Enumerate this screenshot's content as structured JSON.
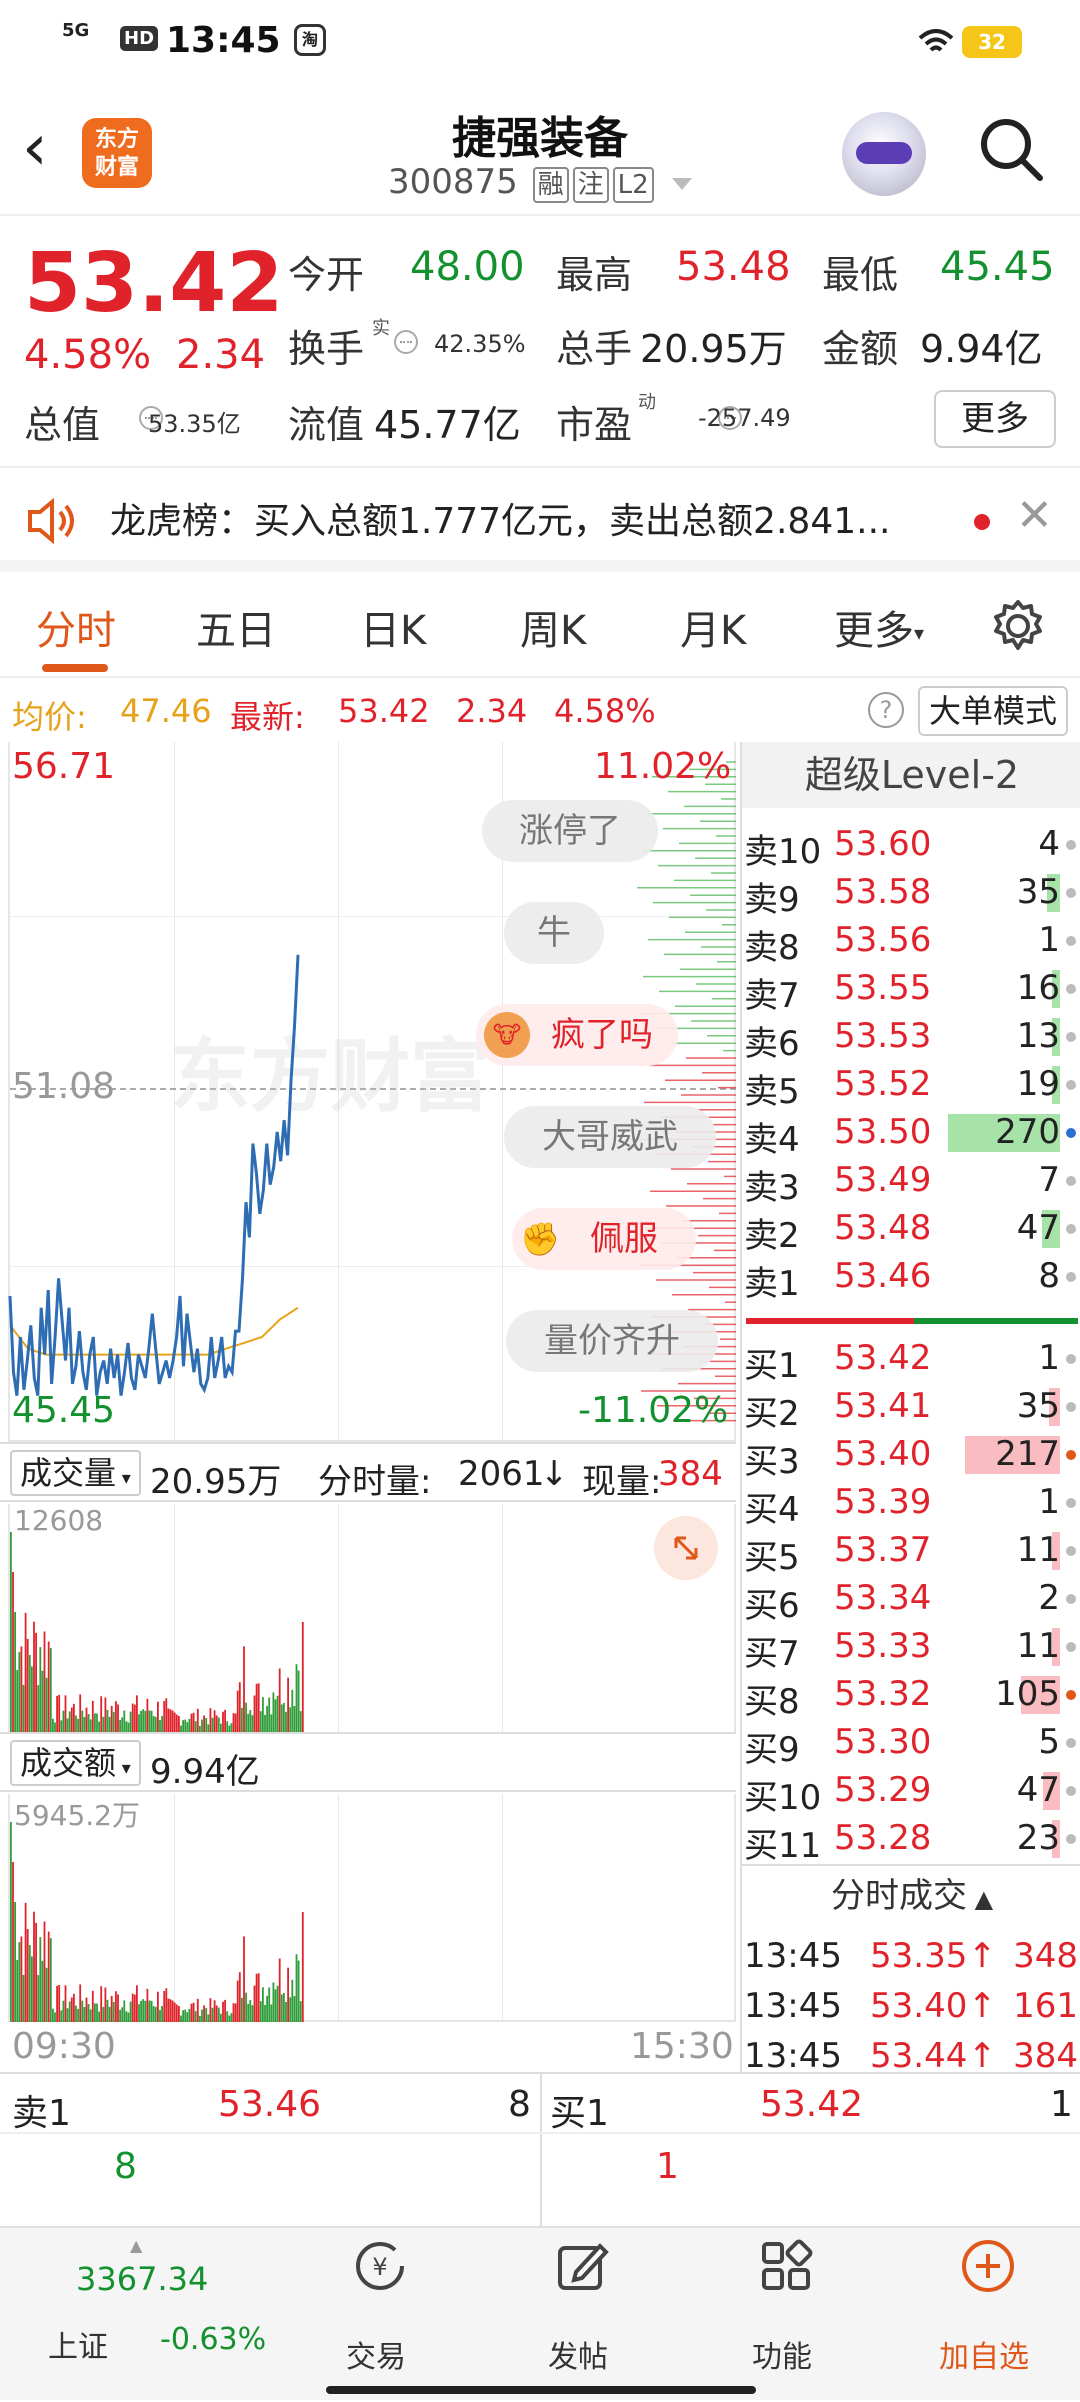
{
  "status": {
    "network": "5G",
    "hd": "HD",
    "time": "13:45",
    "taobao": "淘",
    "battery": "32"
  },
  "header": {
    "back": "‹",
    "logo_line1": "东方",
    "logo_line2": "财富",
    "title": "捷强装备",
    "code": "300875",
    "tags": [
      "融",
      "注",
      "L2"
    ]
  },
  "quote": {
    "price": "53.42",
    "pct": "4.58%",
    "change": "2.34",
    "open_label": "今开",
    "open": "48.00",
    "high_label": "最高",
    "high": "53.48",
    "low_label": "最低",
    "low": "45.45",
    "turnover_label": "换手",
    "turnover_sup": "实",
    "turnover": "42.35%",
    "volume_label": "总手",
    "volume": "20.95万",
    "amount_label": "金额",
    "amount": "9.94亿",
    "mktcap_label": "总值",
    "mktcap": "53.35亿",
    "float_label": "流值",
    "float": "45.77亿",
    "pe_label": "市盈",
    "pe_sup": "动",
    "pe": "-257.49",
    "more": "更多"
  },
  "ticker": {
    "text": "龙虎榜：买入总额1.777亿元，卖出总额2.841..."
  },
  "tabs": [
    "分时",
    "五日",
    "日K",
    "周K",
    "月K",
    "更多"
  ],
  "avg_row": {
    "avg_label": "均价:",
    "avg": "47.46",
    "latest_label": "最新:",
    "latest": "53.42",
    "change": "2.34",
    "pct": "4.58%",
    "mode_btn": "大单模式"
  },
  "chart": {
    "y_high": "56.71",
    "y_mid": "51.08",
    "y_low": "45.45",
    "pct_high": "11.02%",
    "pct_low": "-11.02%",
    "watermark": "东方财富",
    "bubbles": [
      "涨停了",
      "牛",
      "疯了吗",
      "大哥威武",
      "佩服",
      "量价齐升"
    ],
    "vol_select": "成交量",
    "vol_total": "20.95万",
    "vol_tick_label": "分时量:",
    "vol_tick": "2061",
    "vol_tick_arrow": "↓",
    "vol_now_label": "现量:",
    "vol_now": "384",
    "vol_max": "12608",
    "amt_select": "成交额",
    "amt_total": "9.94亿",
    "amt_max": "5945.2万",
    "time_start": "09:30",
    "time_end": "15:30"
  },
  "chart_data": {
    "type": "line",
    "x": [
      "09:30",
      "13:45"
    ],
    "y_range": [
      45.45,
      56.71
    ],
    "reference": 51.08,
    "price": [
      47.6,
      46.3,
      45.9,
      46.9,
      46.0,
      46.5,
      47.1,
      46.2,
      45.9,
      47.4,
      46.6,
      47.7,
      46.1,
      46.9,
      47.9,
      47.2,
      46.5,
      47.4,
      46.1,
      46.4,
      47.0,
      46.3,
      46.0,
      46.6,
      46.9,
      45.9,
      46.3,
      46.5,
      46.1,
      46.7,
      46.2,
      46.6,
      45.9,
      46.3,
      46.8,
      46.2,
      46.0,
      46.6,
      46.4,
      46.2,
      46.7,
      47.3,
      46.7,
      46.1,
      46.3,
      46.5,
      46.2,
      46.5,
      46.9,
      47.6,
      46.4,
      47.3,
      46.8,
      46.3,
      46.7,
      46.1,
      46.0,
      46.2,
      46.9,
      46.2,
      46.5,
      46.9,
      46.2,
      46.4,
      46.3,
      47.0,
      47.0,
      47.9,
      49.2,
      48.6,
      50.2,
      49.7,
      49.0,
      49.4,
      50.2,
      49.5,
      49.8,
      50.4,
      49.9,
      50.6,
      50.0,
      51.3,
      52.2,
      53.42
    ],
    "avg": [
      47.1,
      46.7,
      46.6,
      46.6,
      46.6,
      46.6,
      46.6,
      46.6,
      46.6,
      46.6,
      46.6,
      46.6,
      46.7,
      46.8,
      46.9,
      47.2,
      47.4
    ],
    "volume_bars_note": "intraday volume bars, red up / green down",
    "title": "",
    "xlabel": "",
    "ylabel": ""
  },
  "book": {
    "title": "超级Level-2",
    "asks": [
      {
        "label": "卖10",
        "price": "53.60",
        "vol": "4",
        "bar": 0
      },
      {
        "label": "卖9",
        "price": "53.58",
        "vol": "35",
        "bar": 0.12
      },
      {
        "label": "卖8",
        "price": "53.56",
        "vol": "1",
        "bar": 0
      },
      {
        "label": "卖7",
        "price": "53.55",
        "vol": "16",
        "bar": 0.05
      },
      {
        "label": "卖6",
        "price": "53.53",
        "vol": "13",
        "bar": 0.04
      },
      {
        "label": "卖5",
        "price": "53.52",
        "vol": "19",
        "bar": 0.06
      },
      {
        "label": "卖4",
        "price": "53.50",
        "vol": "270",
        "bar": 1.0
      },
      {
        "label": "卖3",
        "price": "53.49",
        "vol": "7",
        "bar": 0
      },
      {
        "label": "卖2",
        "price": "53.48",
        "vol": "47",
        "bar": 0.16
      },
      {
        "label": "卖1",
        "price": "53.46",
        "vol": "8",
        "bar": 0
      }
    ],
    "bids": [
      {
        "label": "买1",
        "price": "53.42",
        "vol": "1",
        "bar": 0
      },
      {
        "label": "买2",
        "price": "53.41",
        "vol": "35",
        "bar": 0.1
      },
      {
        "label": "买3",
        "price": "53.40",
        "vol": "217",
        "bar": 0.85
      },
      {
        "label": "买4",
        "price": "53.39",
        "vol": "1",
        "bar": 0
      },
      {
        "label": "买5",
        "price": "53.37",
        "vol": "11",
        "bar": 0.03
      },
      {
        "label": "买6",
        "price": "53.34",
        "vol": "2",
        "bar": 0
      },
      {
        "label": "买7",
        "price": "53.33",
        "vol": "11",
        "bar": 0.03
      },
      {
        "label": "买8",
        "price": "53.32",
        "vol": "105",
        "bar": 0.35
      },
      {
        "label": "买9",
        "price": "53.30",
        "vol": "5",
        "bar": 0
      },
      {
        "label": "买10",
        "price": "53.29",
        "vol": "47",
        "bar": 0.15
      },
      {
        "label": "买11",
        "price": "53.28",
        "vol": "23",
        "bar": 0.07
      }
    ],
    "trades_title": "分时成交",
    "trades": [
      {
        "time": "13:45",
        "price": "53.35",
        "arrow": "↑",
        "vol": "348"
      },
      {
        "time": "13:45",
        "price": "53.40",
        "arrow": "↑",
        "vol": "161"
      },
      {
        "time": "13:45",
        "price": "53.44",
        "arrow": "↑",
        "vol": "384"
      }
    ]
  },
  "bidask": {
    "ask_label": "卖1",
    "ask_price": "53.46",
    "ask_vol": "8",
    "ask_sub": "8",
    "bid_label": "买1",
    "bid_price": "53.42",
    "bid_vol": "1",
    "bid_sub": "1"
  },
  "nav": {
    "index_value": "3367.34",
    "index_name": "上证",
    "index_change": "-0.63%",
    "items": [
      "交易",
      "发帖",
      "功能",
      "加自选"
    ]
  }
}
